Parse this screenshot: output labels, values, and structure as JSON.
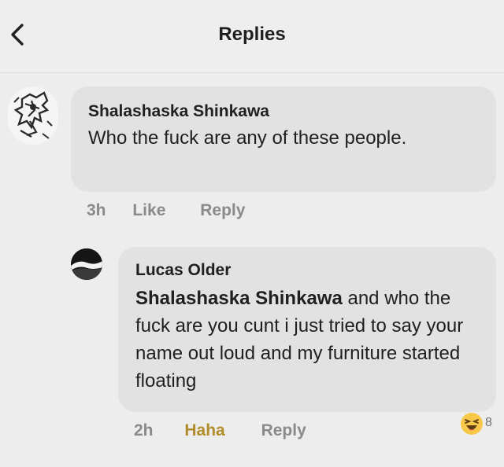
{
  "header": {
    "title": "Replies",
    "back_icon": "chevron-left-icon"
  },
  "comment": {
    "author": "Shalashaska Shinkawa",
    "text": "Who the fuck are any of these people.",
    "time": "3h",
    "like_label": "Like",
    "reply_label": "Reply"
  },
  "reply": {
    "author": "Lucas Older",
    "mention": "Shalashaska Shinkawa",
    "text": " and who the fuck are you cunt i just tried to say your name out loud and my furniture started floating",
    "time": "2h",
    "reaction_label": "Haha",
    "reply_label": "Reply",
    "reaction_icon": "laughing-emoji-icon",
    "reaction_count": "8"
  }
}
